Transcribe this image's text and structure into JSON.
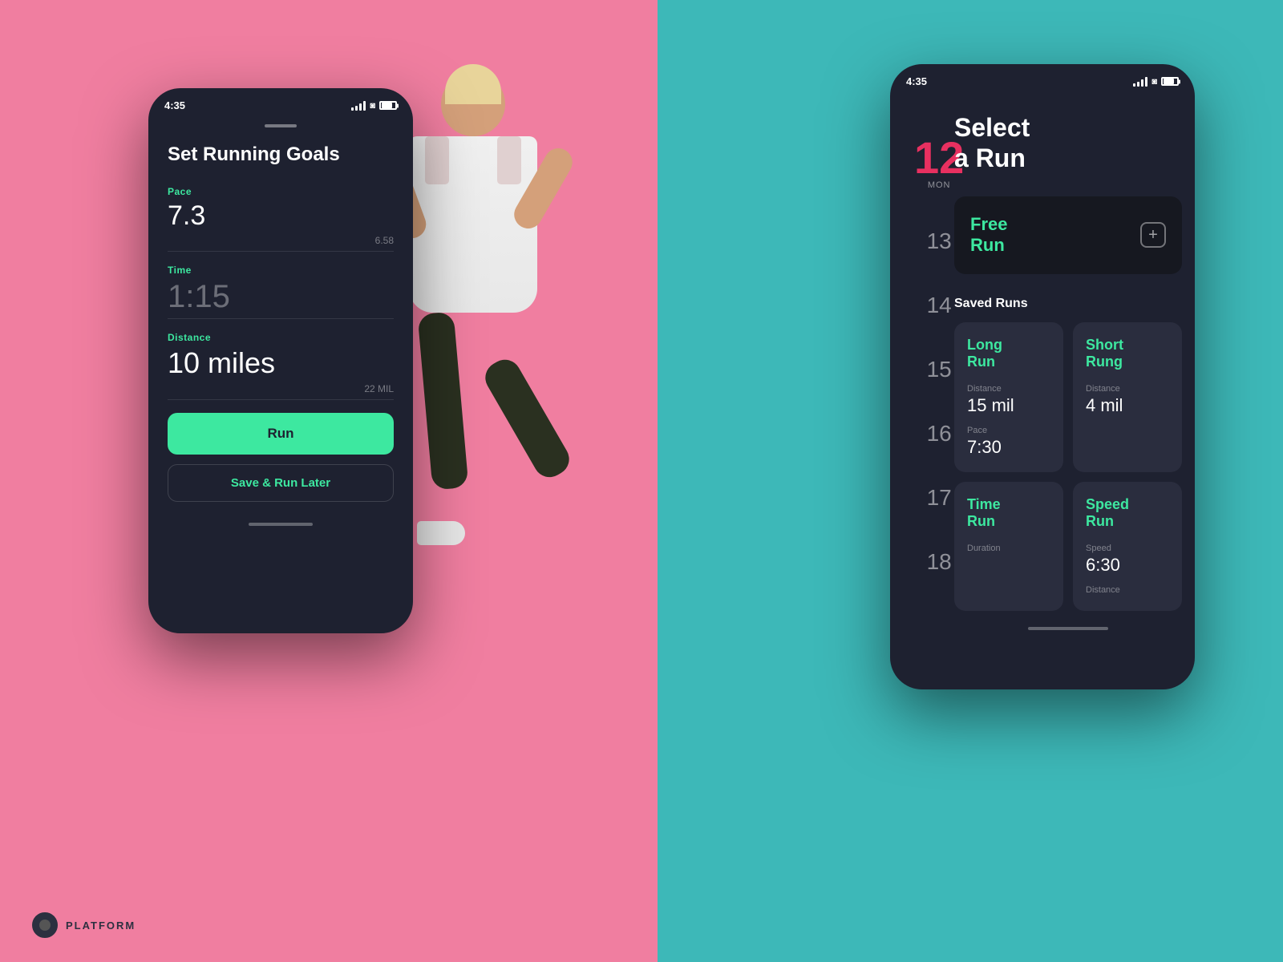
{
  "app": {
    "name": "PLATFORM"
  },
  "left_phone": {
    "status_bar": {
      "time": "4:35"
    },
    "title": "Set Running Goals",
    "metrics": {
      "pace_label": "Pace",
      "pace_value": "7.3",
      "pace_secondary": "6.58",
      "time_label": "Time",
      "time_value": "1:15",
      "distance_label": "Distance",
      "distance_value": "10 miles",
      "distance_secondary": "22 MIL"
    },
    "buttons": {
      "run": "Run",
      "save": "Save & Run Later"
    }
  },
  "right_phone": {
    "status_bar": {
      "time": "4:35"
    },
    "date_items": [
      {
        "number": "12",
        "day": "MON",
        "active": true
      },
      {
        "number": "13",
        "day": "",
        "active": false
      },
      {
        "number": "14",
        "day": "",
        "active": false
      },
      {
        "number": "15",
        "day": "",
        "active": false
      },
      {
        "number": "16",
        "day": "",
        "active": false
      },
      {
        "number": "17",
        "day": "",
        "active": false
      },
      {
        "number": "18",
        "day": "",
        "active": false
      }
    ],
    "title_line1": "Select",
    "title_line2": "a Run",
    "free_run": {
      "label_line1": "Free",
      "label_line2": "Run",
      "plus": "+"
    },
    "saved_runs_label": "Saved Runs",
    "run_cards": [
      {
        "title_line1": "Long",
        "title_line2": "Run",
        "distance_label": "Distance",
        "distance_value": "15 mil",
        "pace_label": "Pace",
        "pace_value": "7:30"
      },
      {
        "title_line1": "Short",
        "title_line2": "Rung",
        "distance_label": "Distance",
        "distance_value": "4 mil",
        "pace_label": "",
        "pace_value": ""
      },
      {
        "title_line1": "Time",
        "title_line2": "Run",
        "distance_label": "Duration",
        "distance_value": "",
        "pace_label": "",
        "pace_value": ""
      },
      {
        "title_line1": "Speed",
        "title_line2": "Run",
        "distance_label": "Speed",
        "distance_value": "6:30",
        "pace_label": "Distance",
        "pace_value": ""
      }
    ]
  }
}
